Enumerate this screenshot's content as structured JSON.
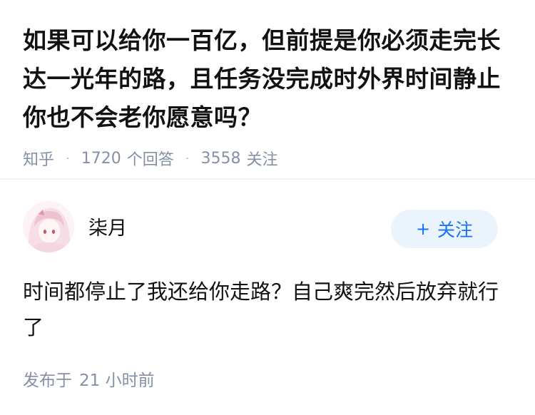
{
  "question": {
    "title": "如果可以给你一百亿，但前提是你必须走完长达一光年的路，且任务没完成时外界时间静止你也不会老你愿意吗？",
    "source": "知乎",
    "answer_count": "1720",
    "answer_label": "个回答",
    "follower_count": "3558",
    "follower_label": "关注"
  },
  "answer": {
    "author": "柒月",
    "follow_button_label": "关注",
    "text": "时间都停止了我还给你走路？自己爽完然后放弃就行了",
    "published_prefix": "发布于",
    "published_time": "21 小时前"
  },
  "icons": {
    "follow_plus": "plus-icon",
    "avatar": "anime-avatar"
  },
  "colors": {
    "text_primary": "#121212",
    "text_meta": "#8590a6",
    "brand_blue": "#1772f6",
    "button_bg": "#ebf4fd"
  }
}
